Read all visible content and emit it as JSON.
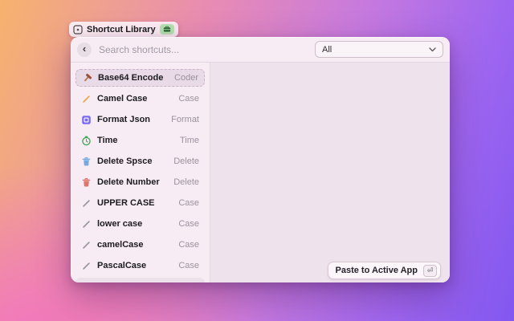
{
  "pill": {
    "title": "Shortcut Library"
  },
  "header": {
    "search_placeholder": "Search shortcuts...",
    "filter_value": "All"
  },
  "list": {
    "items": [
      {
        "label": "Base64 Encode",
        "tag": "Coder",
        "icon": "hammer-icon",
        "color": "#9c523a",
        "selected": true
      },
      {
        "label": "Camel Case",
        "tag": "Case",
        "icon": "pencil-icon",
        "color": "#e8a33c",
        "selected": false
      },
      {
        "label": "Format Json",
        "tag": "Format",
        "icon": "frame-icon",
        "color": "#7a6cf0",
        "selected": false
      },
      {
        "label": "Time",
        "tag": "Time",
        "icon": "clock-icon",
        "color": "#44a85c",
        "selected": false
      },
      {
        "label": "Delete Spsce",
        "tag": "Delete",
        "icon": "trash-icon",
        "color": "#74abe4",
        "selected": false
      },
      {
        "label": "Delete Number",
        "tag": "Delete",
        "icon": "trash-icon",
        "color": "#df766e",
        "selected": false
      },
      {
        "label": "UPPER CASE",
        "tag": "Case",
        "icon": "pencil-icon",
        "color": "#92929c",
        "selected": false
      },
      {
        "label": "lower case",
        "tag": "Case",
        "icon": "pencil-icon",
        "color": "#92929c",
        "selected": false
      },
      {
        "label": "camelCase",
        "tag": "Case",
        "icon": "pencil-icon",
        "color": "#92929c",
        "selected": false
      },
      {
        "label": "PascalCase",
        "tag": "Case",
        "icon": "pencil-icon",
        "color": "#92929c",
        "selected": false
      }
    ],
    "partial_row_visible": true
  },
  "footer": {
    "paste_button_label": "Paste to Active App",
    "key_hint": "⏎"
  },
  "colors": {
    "badge_green": "#b7e2b2",
    "window_bg": "#f7ecf4",
    "right_panel_bg": "#eee2ec",
    "selected_row_bg": "#e8dae6",
    "tag_text": "#9b929e"
  }
}
